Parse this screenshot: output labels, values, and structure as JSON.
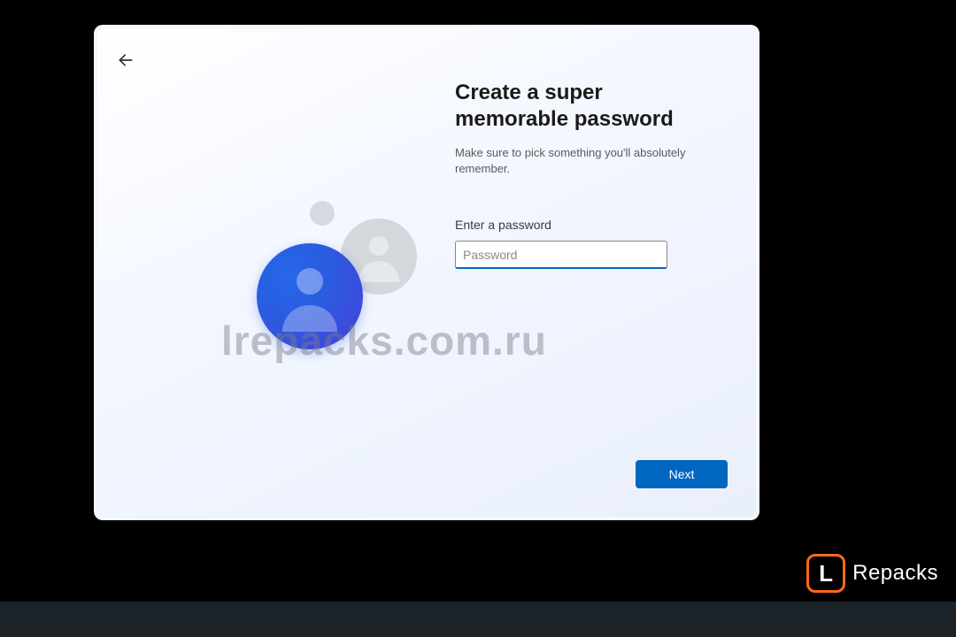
{
  "window": {
    "title": "Create a super memorable password",
    "subtitle": "Make sure to pick something you'll absolutely remember.",
    "password_field": {
      "label": "Enter a password",
      "placeholder": "Password",
      "value": ""
    },
    "next_button_label": "Next"
  },
  "watermark_text": "lrepacks.com.ru",
  "branding": {
    "mark_letter": "L",
    "text": "Repacks"
  },
  "colors": {
    "accent": "#0067c0",
    "brand_orange": "#ff6a1a"
  }
}
